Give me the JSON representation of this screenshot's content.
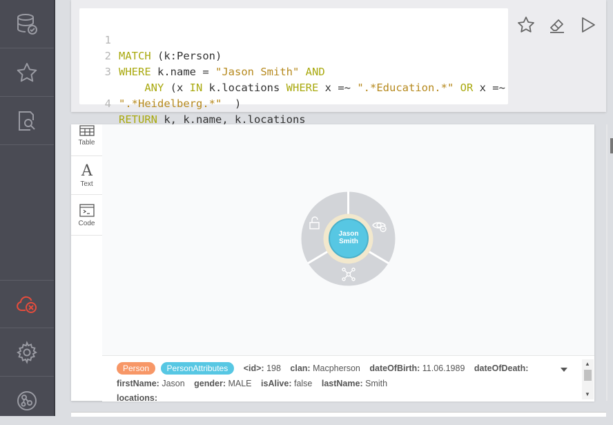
{
  "sidebar": {
    "items": [
      {
        "icon": "database-check-icon",
        "name": "sidebar-database"
      },
      {
        "icon": "star-icon",
        "name": "sidebar-favorites"
      },
      {
        "icon": "document-search-icon",
        "name": "sidebar-documents"
      },
      {
        "icon": "cloud-disconnected-icon",
        "name": "sidebar-connection"
      },
      {
        "icon": "gear-icon",
        "name": "sidebar-settings"
      },
      {
        "icon": "neo4j-browser-icon",
        "name": "sidebar-about"
      }
    ]
  },
  "editor": {
    "lines": [
      {
        "num": "1"
      },
      {
        "num": "2"
      },
      {
        "num": "3"
      },
      {
        "num": ""
      },
      {
        "num": "4"
      }
    ],
    "t1a": "MATCH",
    " t1b": "",
    "t1_rest": " (k:Person)",
    "t2a": "WHERE",
    " t2b": "",
    "t2_mid": " k.name = ",
    "t2_str": "\"Jason Smith\"",
    "t2_and": " AND",
    "t3_any": "    ANY",
    "t3_mid1": " (x ",
    "t3_in": "IN",
    "t3_mid2": " k.locations ",
    "t3_where": "WHERE",
    "t3_mid3": " x =~ ",
    "t3_str": "\".*Education.*\"",
    "t3_or": " OR",
    "t3_mid4": " x =~",
    "t3b_str": "\".*Heidelberg.*\"",
    "t3b_rest": "  )",
    "t4_ret": "RETURN",
    "t4_rest": " k, k.name, k.locations"
  },
  "toolbar": {
    "favorite_icon": "star-outline-icon",
    "clear_icon": "eraser-icon",
    "run_icon": "play-icon"
  },
  "view_tabs": [
    {
      "label": "Table",
      "icon": "table-icon"
    },
    {
      "label": "Text",
      "icon": "text-icon"
    },
    {
      "label": "Code",
      "icon": "code-icon"
    }
  ],
  "graph": {
    "node_line1": "Jason",
    "node_line2": "Smith",
    "node_color": "#57c7e3",
    "ring_color": "#d2d4d8"
  },
  "inspector": {
    "labels": [
      {
        "text": "Person",
        "color": "#f79767"
      },
      {
        "text": "PersonAttributes",
        "color": "#57c7e3"
      }
    ],
    "row1": [
      {
        "k": "<id>:",
        "v": "198"
      },
      {
        "k": "clan:",
        "v": "Macpherson"
      },
      {
        "k": "dateOfBirth:",
        "v": "11.06.1989"
      },
      {
        "k": "dateOfDeath:",
        "v": ""
      }
    ],
    "row2": [
      {
        "k": "firstName:",
        "v": "Jason"
      },
      {
        "k": "gender:",
        "v": "MALE"
      },
      {
        "k": "isAlive:",
        "v": "false"
      },
      {
        "k": "lastName:",
        "v": "Smith"
      }
    ],
    "row3": [
      {
        "k": "locations:",
        "v": ""
      }
    ]
  }
}
